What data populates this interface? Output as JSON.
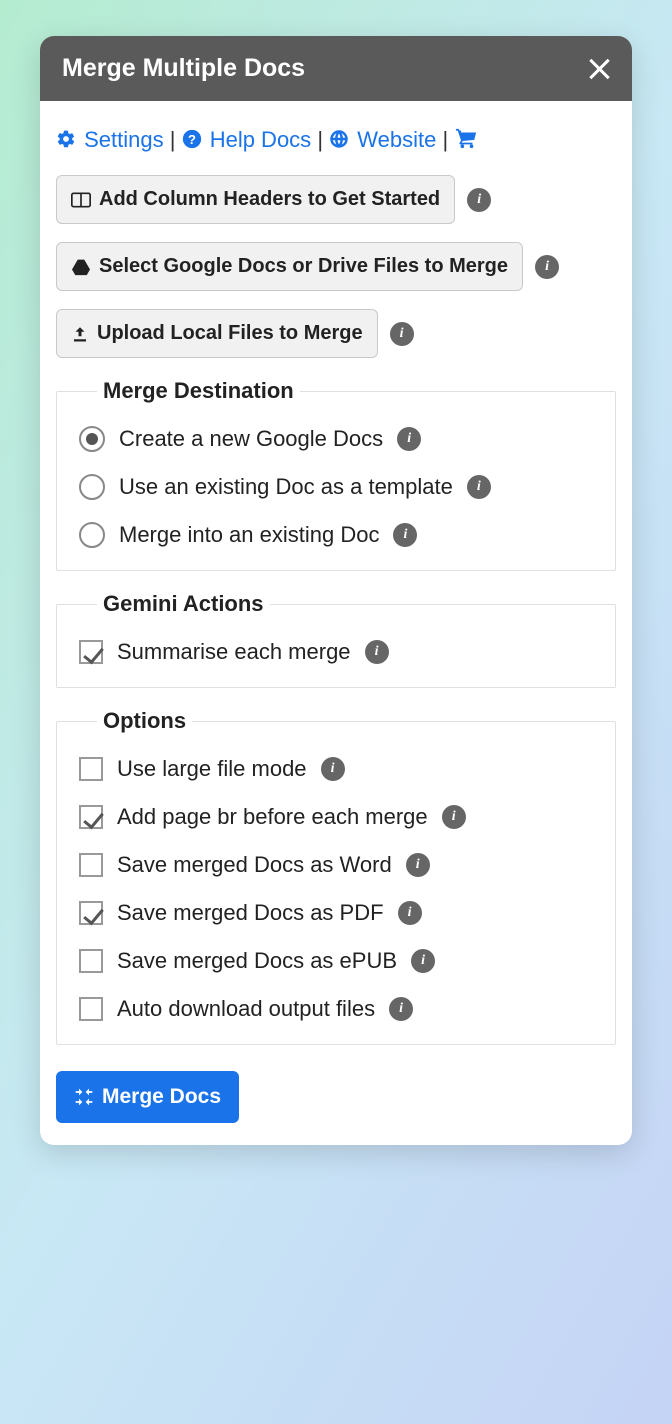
{
  "header": {
    "title": "Merge Multiple Docs"
  },
  "nav": {
    "settings": "Settings",
    "helpdocs": "Help Docs",
    "website": "Website"
  },
  "actions": {
    "addHeaders": "Add Column Headers to Get Started",
    "selectDocs": "Select Google Docs or Drive Files to Merge",
    "uploadLocal": "Upload Local Files to Merge"
  },
  "destination": {
    "legend": "Merge Destination",
    "createNew": "Create a new Google Docs",
    "useTemplate": "Use an existing Doc as a template",
    "mergeExisting": "Merge into an existing Doc",
    "selected": "createNew"
  },
  "gemini": {
    "legend": "Gemini Actions",
    "summarise": {
      "label": "Summarise each merge",
      "checked": true
    }
  },
  "options": {
    "legend": "Options",
    "largeFile": {
      "label": "Use large file mode",
      "checked": false
    },
    "pageBreak": {
      "label": "Add page br before each merge",
      "checked": true
    },
    "saveWord": {
      "label": "Save merged Docs as Word",
      "checked": false
    },
    "savePDF": {
      "label": "Save merged Docs as PDF",
      "checked": true
    },
    "saveEPUB": {
      "label": "Save merged Docs as ePUB",
      "checked": false
    },
    "autoDL": {
      "label": "Auto download output files",
      "checked": false
    }
  },
  "mergeButton": "Merge Docs"
}
